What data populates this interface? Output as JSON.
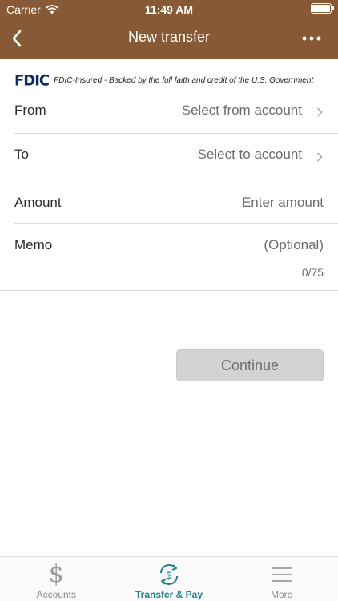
{
  "status_bar": {
    "carrier": "Carrier",
    "time": "11:49 AM"
  },
  "nav": {
    "title": "New transfer"
  },
  "fdic": {
    "logo": "FDIC",
    "text": "FDIC-Insured - Backed by the full faith and credit of the U.S. Government"
  },
  "form": {
    "from": {
      "label": "From",
      "placeholder": "Select from account"
    },
    "to": {
      "label": "To",
      "placeholder": "Select to account"
    },
    "amount": {
      "label": "Amount",
      "placeholder": "Enter amount"
    },
    "memo": {
      "label": "Memo",
      "placeholder": "(Optional)",
      "counter": "0/75"
    }
  },
  "continue_label": "Continue",
  "tabs": [
    {
      "label": "Accounts",
      "icon": "dollar-icon",
      "active": false
    },
    {
      "label": "Transfer & Pay",
      "icon": "transfer-pay-icon",
      "active": true
    },
    {
      "label": "More",
      "icon": "hamburger-menu-icon",
      "active": false
    }
  ],
  "colors": {
    "header": "#875a35",
    "accent": "#1f7f84",
    "fdic_blue": "#0d2a5c",
    "button_disabled": "#d3d3d3"
  }
}
